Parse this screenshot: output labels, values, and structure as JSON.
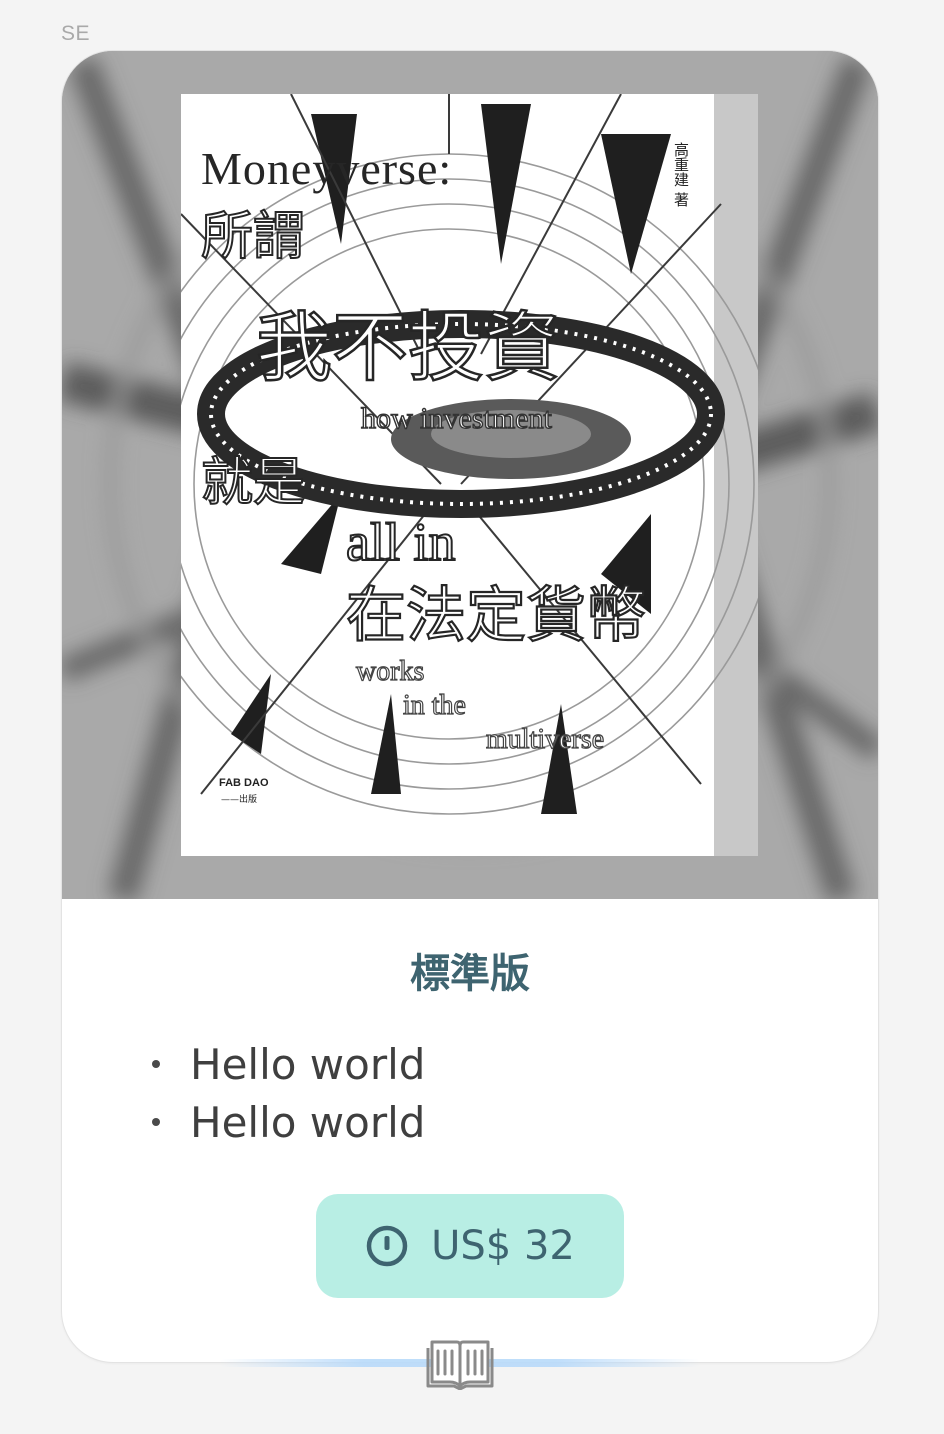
{
  "header": {
    "corner_label": "SE"
  },
  "cover": {
    "title_en": "Moneyverse:",
    "title_zh_1": "所謂",
    "title_zh_2": "我不投資",
    "title_zh_3": "就是",
    "title_zh_4": "在法定貨幣",
    "en_line_1": "how investment",
    "en_line_2": "all in",
    "en_line_3": "works",
    "en_line_4": "in the",
    "en_line_5": "multiverse",
    "author": "高重建 著",
    "publisher": "FAB DAO",
    "publisher_sub": "——出版"
  },
  "product": {
    "edition_title": "標準版",
    "features": [
      "Hello world",
      "Hello world"
    ],
    "price_label": "US$ 32",
    "price_icon": "info-circle-icon",
    "footer_icon": "open-book-icon"
  },
  "colors": {
    "accent_text": "#3e6470",
    "price_button_bg": "#b8eee4",
    "card_bg": "#ffffff",
    "page_bg": "#f4f4f4"
  }
}
